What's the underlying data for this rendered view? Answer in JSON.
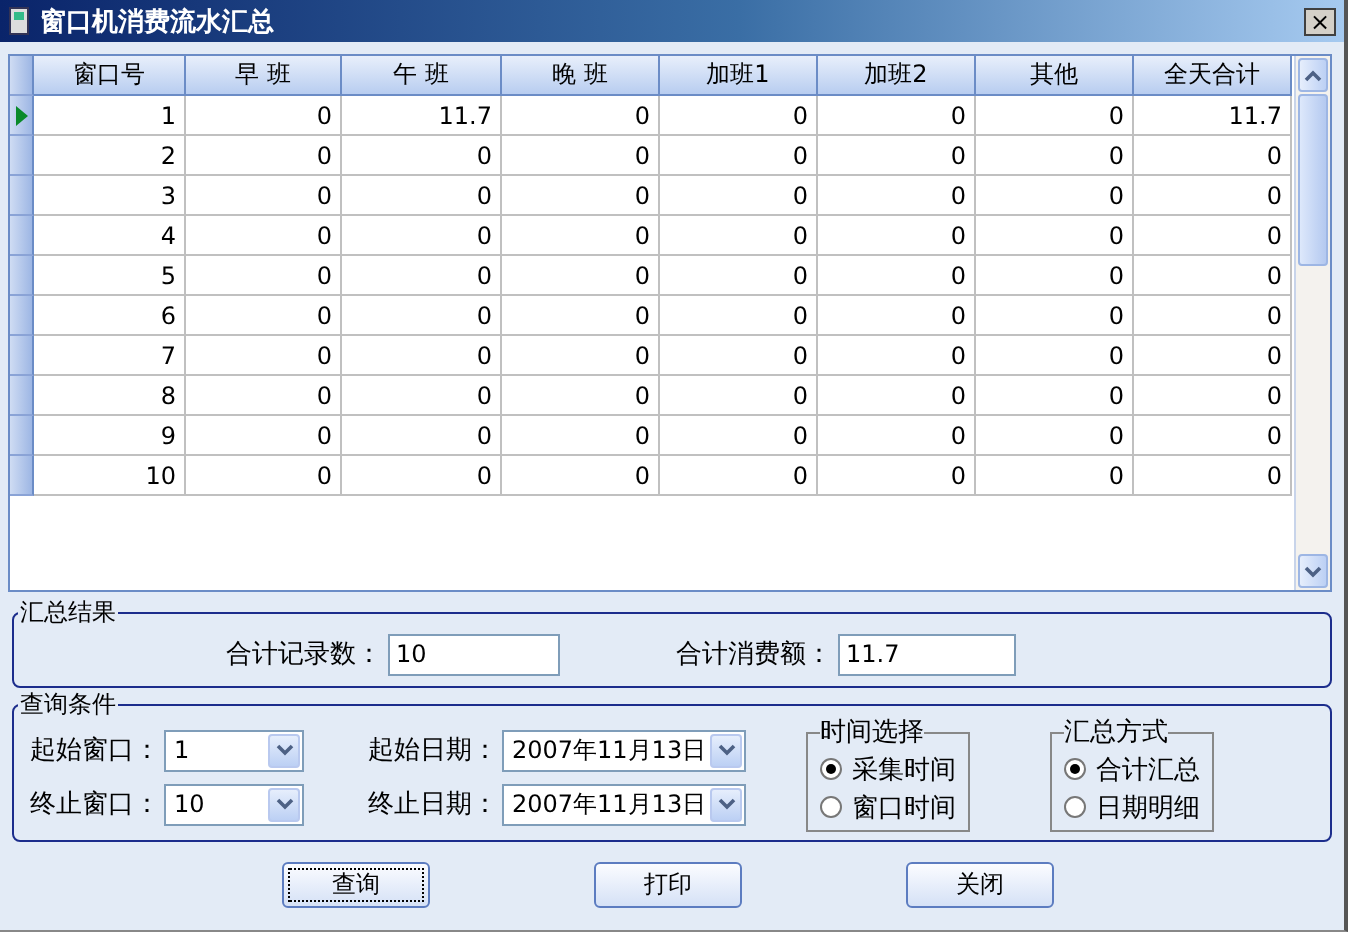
{
  "window": {
    "title": "窗口机消费流水汇总",
    "close": "×"
  },
  "table": {
    "columns": [
      "窗口号",
      "早 班",
      "午 班",
      "晚 班",
      "加班1",
      "加班2",
      "其他",
      "全天合计"
    ],
    "rows": [
      {
        "selected": true,
        "cells": [
          "1",
          "0",
          "11.7",
          "0",
          "0",
          "0",
          "0",
          "11.7"
        ]
      },
      {
        "selected": false,
        "cells": [
          "2",
          "0",
          "0",
          "0",
          "0",
          "0",
          "0",
          "0"
        ]
      },
      {
        "selected": false,
        "cells": [
          "3",
          "0",
          "0",
          "0",
          "0",
          "0",
          "0",
          "0"
        ]
      },
      {
        "selected": false,
        "cells": [
          "4",
          "0",
          "0",
          "0",
          "0",
          "0",
          "0",
          "0"
        ]
      },
      {
        "selected": false,
        "cells": [
          "5",
          "0",
          "0",
          "0",
          "0",
          "0",
          "0",
          "0"
        ]
      },
      {
        "selected": false,
        "cells": [
          "6",
          "0",
          "0",
          "0",
          "0",
          "0",
          "0",
          "0"
        ]
      },
      {
        "selected": false,
        "cells": [
          "7",
          "0",
          "0",
          "0",
          "0",
          "0",
          "0",
          "0"
        ]
      },
      {
        "selected": false,
        "cells": [
          "8",
          "0",
          "0",
          "0",
          "0",
          "0",
          "0",
          "0"
        ]
      },
      {
        "selected": false,
        "cells": [
          "9",
          "0",
          "0",
          "0",
          "0",
          "0",
          "0",
          "0"
        ]
      },
      {
        "selected": false,
        "cells": [
          "10",
          "0",
          "0",
          "0",
          "0",
          "0",
          "0",
          "0"
        ]
      }
    ]
  },
  "summary": {
    "title": "汇总结果",
    "fields": [
      {
        "label": "合计记录数：",
        "value": "10"
      },
      {
        "label": "合计消费额：",
        "value": "11.7"
      }
    ]
  },
  "query": {
    "title": "查询条件",
    "window_fields": [
      {
        "label": "起始窗口：",
        "value": "1"
      },
      {
        "label": "终止窗口：",
        "value": "10"
      }
    ],
    "date_fields": [
      {
        "label": "起始日期：",
        "value": "2007年11月13日"
      },
      {
        "label": "终止日期：",
        "value": "2007年11月13日"
      }
    ],
    "time_choice": {
      "title": "时间选择",
      "options": [
        {
          "label": "采集时间",
          "selected": true
        },
        {
          "label": "窗口时间",
          "selected": false
        }
      ]
    },
    "summary_mode": {
      "title": "汇总方式",
      "options": [
        {
          "label": "合计汇总",
          "selected": true
        },
        {
          "label": "日期明细",
          "selected": false
        }
      ]
    }
  },
  "buttons": [
    {
      "label": "查询",
      "focused": true
    },
    {
      "label": "打印",
      "focused": false
    },
    {
      "label": "关闭",
      "focused": false
    }
  ]
}
